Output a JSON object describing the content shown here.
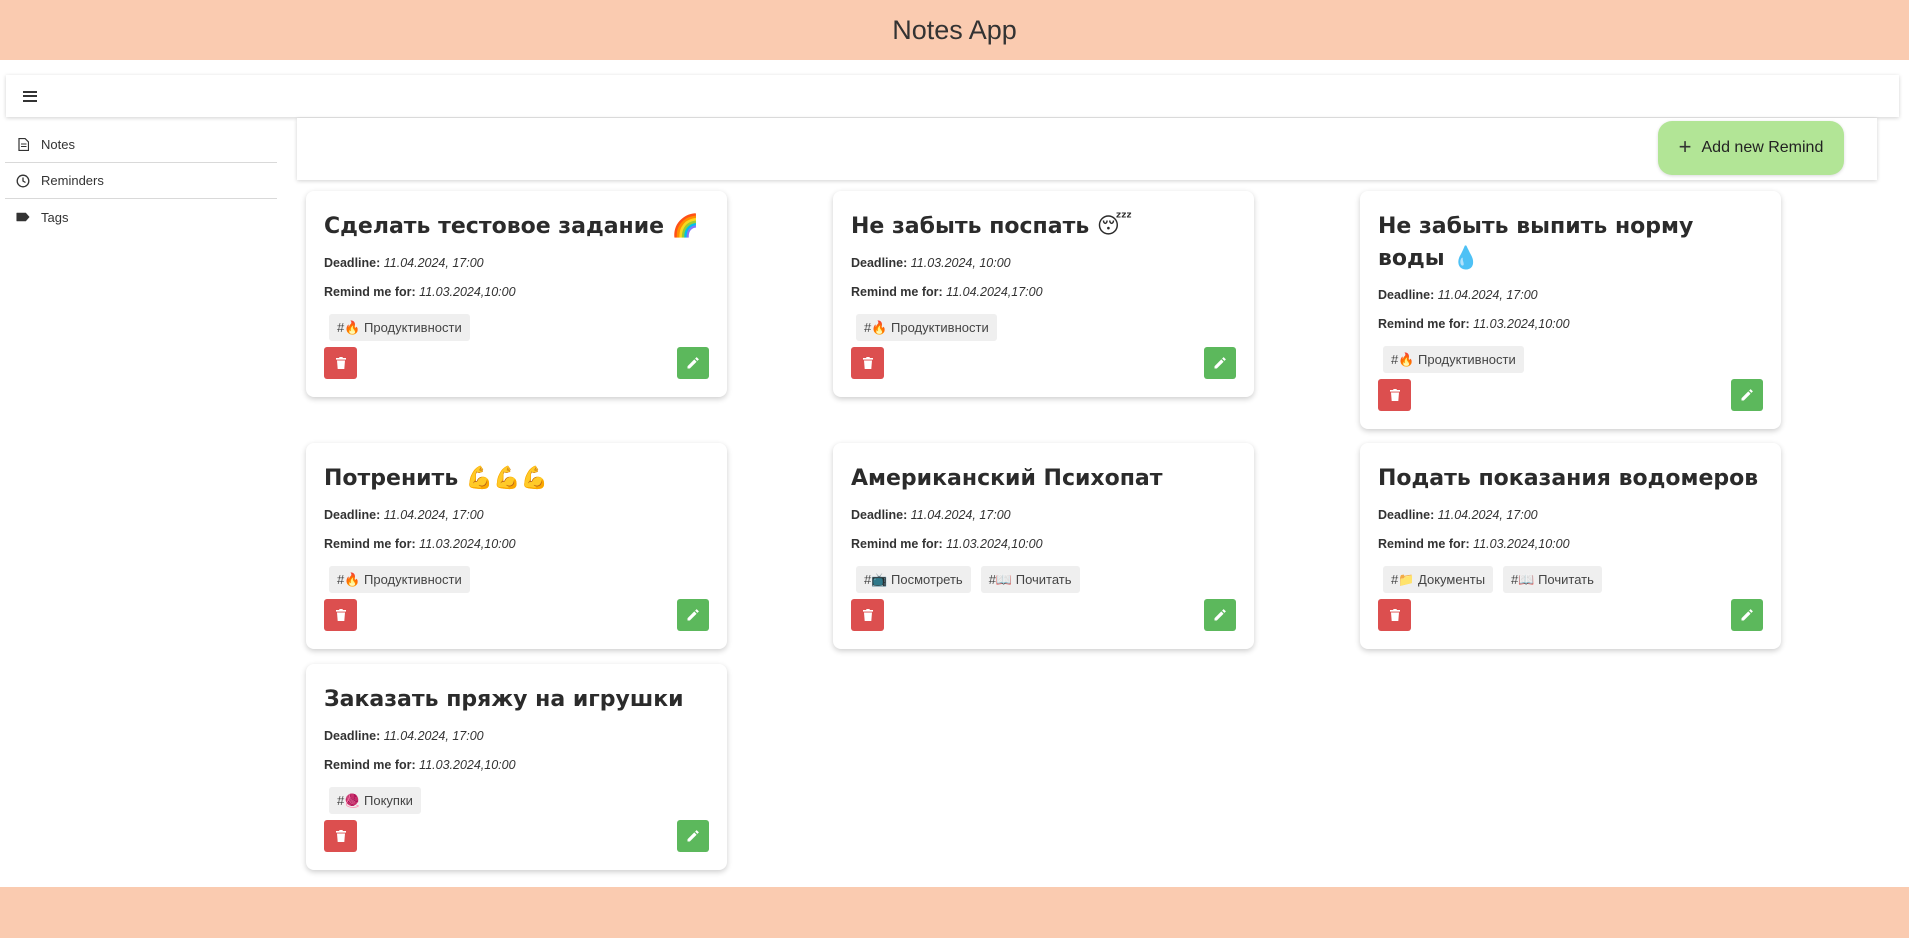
{
  "app": {
    "title": "Notes App"
  },
  "sidebar": {
    "items": [
      {
        "label": "Notes",
        "icon": "note-icon"
      },
      {
        "label": "Reminders",
        "icon": "clock-icon"
      },
      {
        "label": "Tags",
        "icon": "tag-icon"
      }
    ]
  },
  "toolbar": {
    "add_label": "Add new Remind",
    "add_icon": "+"
  },
  "labels": {
    "deadline": "Deadline:",
    "remind": "Remind me for:"
  },
  "cards": [
    {
      "title": "Сделать тестовое задание 🌈",
      "deadline": "11.04.2024, 17:00",
      "remind": "11.03.2024,10:00",
      "tags": [
        "#🔥 Продуктивности"
      ]
    },
    {
      "title": "Не забыть поспать 😴",
      "deadline": "11.03.2024, 10:00",
      "remind": "11.04.2024,17:00",
      "tags": [
        "#🔥 Продуктивности"
      ]
    },
    {
      "title": "Не забыть выпить норму воды 💧",
      "deadline": "11.04.2024, 17:00",
      "remind": "11.03.2024,10:00",
      "tags": [
        "#🔥 Продуктивности"
      ]
    },
    {
      "title": "Потренить 💪💪💪",
      "deadline": "11.04.2024, 17:00",
      "remind": "11.03.2024,10:00",
      "tags": [
        "#🔥 Продуктивности"
      ]
    },
    {
      "title": "Американский Психопат",
      "deadline": "11.04.2024, 17:00",
      "remind": "11.03.2024,10:00",
      "tags": [
        "#📺 Посмотреть",
        "#📖 Почитать"
      ]
    },
    {
      "title": "Подать показания водомеров",
      "deadline": "11.04.2024, 17:00",
      "remind": "11.03.2024,10:00",
      "tags": [
        "#📁 Документы",
        "#📖 Почитать"
      ]
    },
    {
      "title": "Заказать пряжу на игрушки",
      "deadline": "11.04.2024, 17:00",
      "remind": "11.03.2024,10:00",
      "tags": [
        "#🧶 Покупки"
      ]
    }
  ],
  "colors": {
    "header_bg": "#facbb0",
    "add_button_bg": "#b2e596",
    "delete_bg": "#dc4f4f",
    "edit_bg": "#5cb85c",
    "tag_bg": "#efefef"
  },
  "icons": {
    "delete": "trash-icon",
    "edit": "pencil-icon",
    "menu": "hamburger-icon"
  }
}
